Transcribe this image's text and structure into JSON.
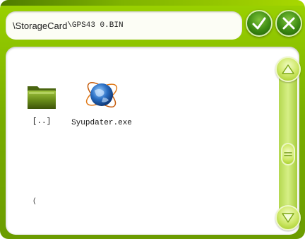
{
  "path_bar": {
    "segment1": "\\StorageCard",
    "segment2": "\\GPS43 0.BIN"
  },
  "buttons": {
    "ok_icon": "check-icon",
    "cancel_icon": "x-icon"
  },
  "files": [
    {
      "label": "[..]",
      "icon": "folder-icon"
    },
    {
      "label": "Syupdater.exe",
      "icon": "globe-icon"
    }
  ],
  "stray_text": "(",
  "scrollbar": {
    "up_icon": "triangle-up-icon",
    "down_icon": "triangle-down-icon",
    "thumb_icon": "equals-icon"
  },
  "colors": {
    "frame": "#84b800",
    "button": "#3c8a12",
    "scrollbar": "#cfe86a"
  }
}
